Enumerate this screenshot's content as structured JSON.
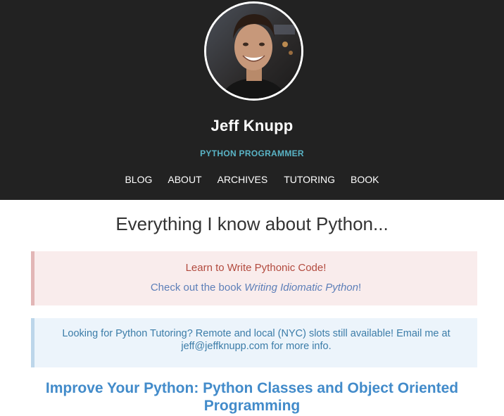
{
  "header": {
    "site_name": "Jeff Knupp",
    "tagline": "PYTHON PROGRAMMER",
    "nav": [
      "BLOG",
      "ABOUT",
      "ARCHIVES",
      "TUTORING",
      "BOOK"
    ],
    "background_color": "#222222",
    "tagline_color": "#5ab4c6"
  },
  "main": {
    "heading": "Everything I know about Python...",
    "book_alert": {
      "title": "Learn to Write Pythonic Code!",
      "prefix": "Check out the book ",
      "book_link": "Writing Idiomatic Python",
      "suffix": "!"
    },
    "tutoring_alert": {
      "text": "Looking for Python Tutoring? Remote and local (NYC) slots still available! Email me at jeff@jeffknupp.com for more info."
    },
    "post_title": "Improve Your Python: Python Classes and Object Oriented Programming",
    "link_color": "#428bca"
  }
}
